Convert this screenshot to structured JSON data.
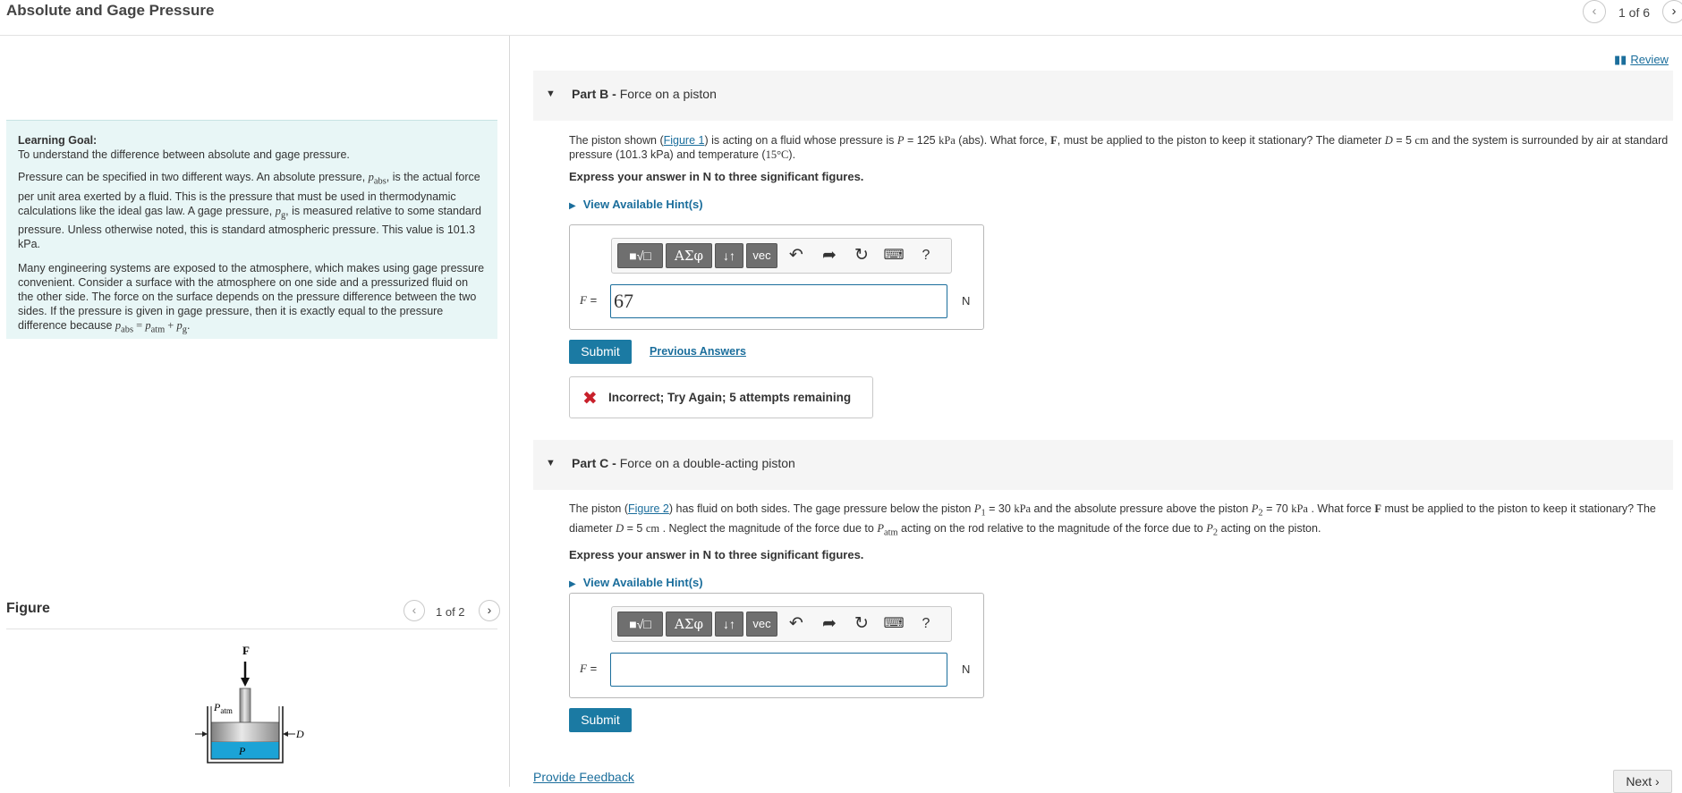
{
  "header": {
    "title": "Absolute and Gage Pressure",
    "prev_icon": "chevron-left-icon",
    "next_icon": "chevron-right-icon",
    "count": "1 of 6"
  },
  "review": {
    "label": "Review",
    "icon": "book-icon"
  },
  "learning_goal": {
    "heading": "Learning Goal:",
    "goal": "To understand the difference between absolute and gage pressure.",
    "p1": {
      "a": "Pressure can be specified in two different ways. An absolute pressure, ",
      "sym_abs": "p",
      "sub_abs": "abs",
      "b": ", is the actual force per unit area exerted by a fluid. This is the pressure that must be used in thermodynamic calculations like the ideal gas law. A gage pressure, ",
      "sym_g": "p",
      "sub_g": "g",
      "c": ", is measured relative to some standard pressure. Unless otherwise noted, this is standard atmospheric pressure. This value is 101.3 kPa."
    },
    "p2": {
      "a": "Many engineering systems are exposed to the atmosphere, which makes using gage pressure convenient. Consider a surface with the atmosphere on one side and a pressurized fluid on the other side. The force on the surface depends on the pressure difference between the two sides. If the pressure is given in gage pressure, then it is exactly equal to the pressure difference because ",
      "eq_lhs": "p",
      "eq_lhs_sub": "abs",
      "eq_mid": " = ",
      "eq_r1": "p",
      "eq_r1_sub": "atm",
      "eq_plus": " + ",
      "eq_r2": "p",
      "eq_r2_sub": "g",
      "end": "."
    }
  },
  "figure": {
    "title": "Figure",
    "count": "1 of 2",
    "labels": {
      "force": "F",
      "atm": "P",
      "atm_sub": "atm",
      "diameter": "D",
      "pressure": "P"
    }
  },
  "partB": {
    "label": "Part B",
    "sep": " - ",
    "title": "Force on a piston",
    "q": {
      "a": "The piston shown (",
      "fig_link": "Figure 1",
      "b": ") is acting on a fluid whose pressure is ",
      "P": "P",
      "c": " = 125 ",
      "kpa": "kPa",
      "d": " (abs). What force, ",
      "F": "F",
      "e": ", must be applied to the piston to keep it stationary? The diameter ",
      "D": "D",
      "f": " = 5 ",
      "cm": "cm",
      "g": " and the system is surrounded by air at standard pressure (101.3 kPa) and temperature (",
      "temp": "15°C",
      "h": ")."
    },
    "instruction": "Express your answer in N to three significant figures.",
    "hint": "View Available Hint(s)",
    "var": "F",
    "eq": " =",
    "value": "67",
    "unit": "N",
    "submit": "Submit",
    "previous_answers": "Previous Answers",
    "feedback": "Incorrect; Try Again; 5 attempts remaining"
  },
  "partC": {
    "label": "Part C",
    "sep": " - ",
    "title": "Force on a double-acting piston",
    "q": {
      "a": "The piston (",
      "fig_link": "Figure 2",
      "b": ") has fluid on both sides. The gage pressure below the piston ",
      "P1": "P",
      "P1_sub": "1",
      "c": " = 30 ",
      "kpa1": "kPa",
      "d": " and the absolute pressure above the piston ",
      "P2": "P",
      "P2_sub": "2",
      "e": " = 70 ",
      "kpa2": "kPa",
      "f": " . What force ",
      "F": "F",
      "g": " must be applied to the piston to keep it stationary? The diameter ",
      "D": "D",
      "h": " = 5 ",
      "cm": "cm",
      "i": " . Neglect the magnitude of the force due to ",
      "Patm": "P",
      "Patm_sub": "atm",
      "j": " acting on the rod relative to the magnitude of the force due to ",
      "P2b": "P",
      "P2b_sub": "2",
      "k": " acting on the piston."
    },
    "instruction": "Express your answer in N to three significant figures.",
    "hint": "View Available Hint(s)",
    "var": "F",
    "eq": " =",
    "value": "",
    "unit": "N",
    "submit": "Submit"
  },
  "toolbar": {
    "radical": "■√□",
    "greek": "ΑΣφ",
    "arrows": "↓↑",
    "vec": "vec",
    "undo_icon": "undo-icon",
    "redo_icon": "redo-icon",
    "reset_icon": "reset-icon",
    "keyboard_icon": "keyboard-icon",
    "help": "?"
  },
  "footer": {
    "provide_feedback": "Provide Feedback",
    "next": "Next"
  },
  "colors": {
    "accent": "#1b7aa3",
    "link": "#1b6e9c",
    "goal_bg": "#e8f6f6",
    "fluid": "#1ba3d6",
    "error": "#c8202b"
  }
}
